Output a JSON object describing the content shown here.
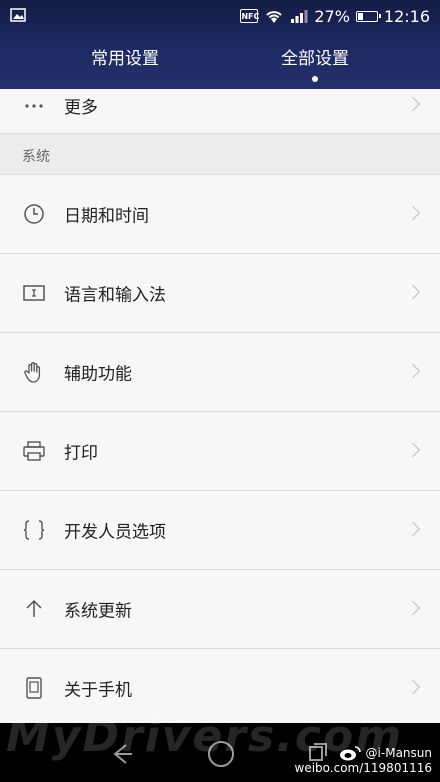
{
  "status_bar": {
    "nfc": "NFC",
    "battery": "27%",
    "battery_level": 0.27,
    "time": "12:16"
  },
  "tabs": [
    {
      "label": "常用设置"
    },
    {
      "label": "全部设置",
      "selected": true
    }
  ],
  "list": {
    "more_label": "更多",
    "section_system": "系统",
    "items": [
      {
        "label": "日期和时间",
        "icon": "clock-icon"
      },
      {
        "label": "语言和输入法",
        "icon": "keyboard-icon"
      },
      {
        "label": "辅助功能",
        "icon": "hand-icon"
      },
      {
        "label": "打印",
        "icon": "printer-icon"
      },
      {
        "label": "开发人员选项",
        "icon": "braces-icon"
      },
      {
        "label": "系统更新",
        "icon": "arrow-up-icon"
      },
      {
        "label": "关于手机",
        "icon": "phone-icon"
      }
    ]
  },
  "navbar": {
    "weibo_handle": "@i-Mansun",
    "weibo_url": "weibo.com/119801116"
  },
  "watermark": "MyDrivers.com"
}
